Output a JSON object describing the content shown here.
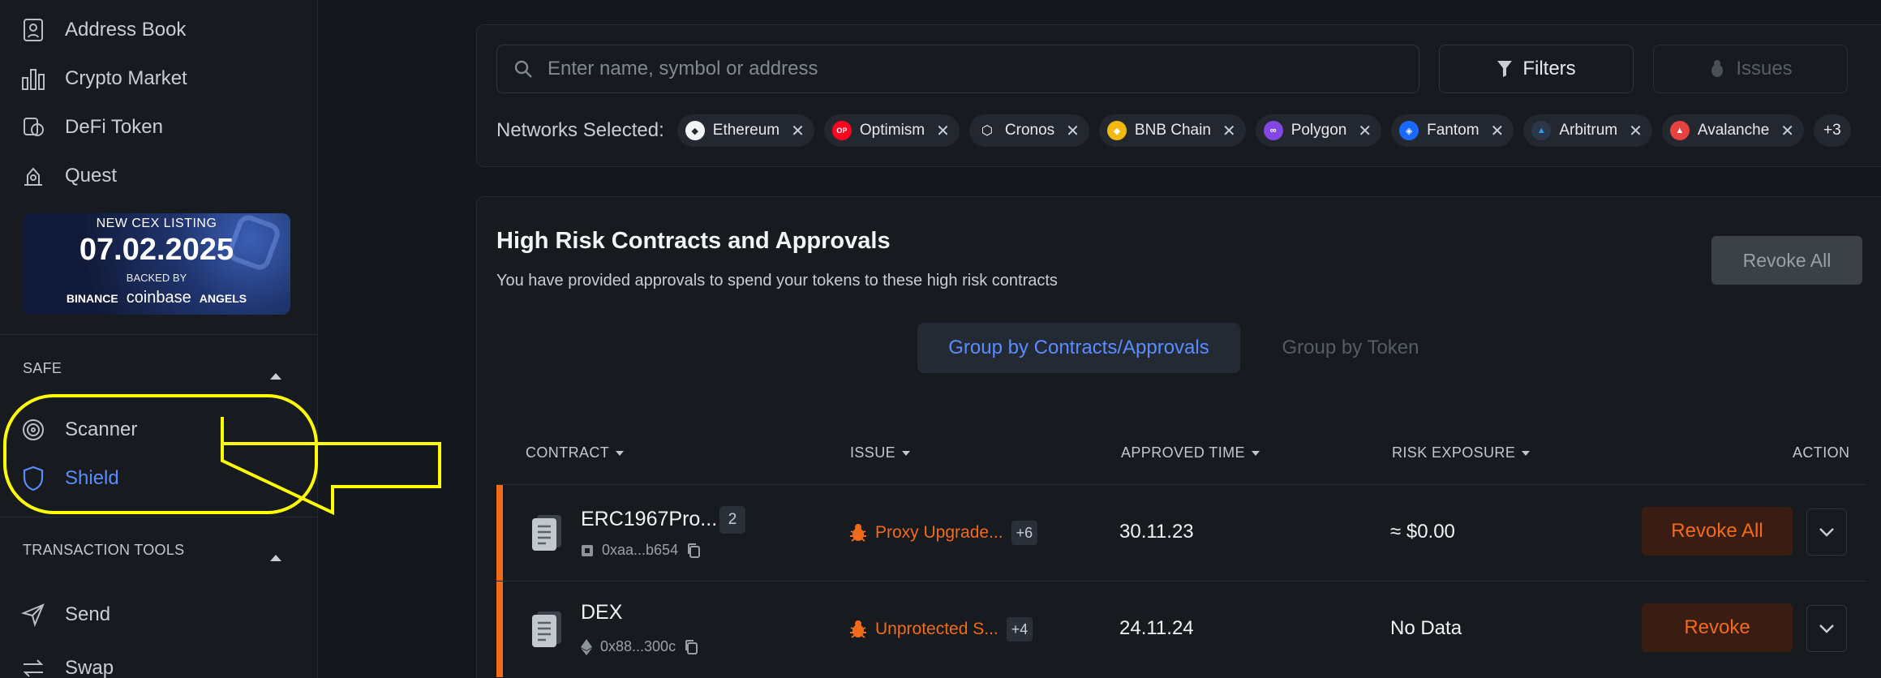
{
  "sidebar": {
    "nav_top": [
      {
        "label": "Address Book",
        "icon": "address-book-icon"
      },
      {
        "label": "Crypto Market",
        "icon": "bar-chart-icon"
      },
      {
        "label": "DeFi Token",
        "icon": "defi-token-icon"
      },
      {
        "label": "Quest",
        "icon": "quest-icon"
      }
    ],
    "banner": {
      "line1": "NEW CEX LISTING",
      "date": "07.02.2025",
      "line3": "BACKED BY",
      "partners": [
        "BINANCE",
        "coinbase",
        "ANGELS"
      ]
    },
    "safe_label": "SAFE",
    "safe_items": [
      {
        "label": "Scanner",
        "icon": "scanner-icon"
      },
      {
        "label": "Shield",
        "icon": "shield-icon"
      }
    ],
    "tx_tools_label": "TRANSACTION TOOLS",
    "tx_items": [
      {
        "label": "Send",
        "icon": "send-icon"
      },
      {
        "label": "Swap",
        "icon": "swap-icon"
      }
    ]
  },
  "filters": {
    "search_placeholder": "Enter name, symbol or address",
    "filters_label": "Filters",
    "issues_label": "Issues",
    "networks_label": "Networks Selected:",
    "networks": [
      {
        "name": "Ethereum",
        "color": "#e6e8eb",
        "glyph": "◆"
      },
      {
        "name": "Optimism",
        "color": "#ff0420",
        "glyph": "OP"
      },
      {
        "name": "Cronos",
        "color": "#ffffff",
        "glyph": "⬡"
      },
      {
        "name": "BNB Chain",
        "color": "#f0b90b",
        "glyph": "◆"
      },
      {
        "name": "Polygon",
        "color": "#8247e5",
        "glyph": "∞"
      },
      {
        "name": "Fantom",
        "color": "#1969ff",
        "glyph": "◈"
      },
      {
        "name": "Arbitrum",
        "color": "#2d374b",
        "glyph": "▲"
      },
      {
        "name": "Avalanche",
        "color": "#e84142",
        "glyph": "▲"
      }
    ],
    "more_networks": "+3"
  },
  "risk": {
    "title": "High Risk Contracts and Approvals",
    "subtitle": "You have provided approvals to spend your tokens to these high risk contracts",
    "revoke_all_label": "Revoke All",
    "group_tabs": [
      "Group by Contracts/Approvals",
      "Group by Token"
    ],
    "columns": [
      "CONTRACT",
      "ISSUE",
      "APPROVED TIME",
      "RISK EXPOSURE",
      "ACTION"
    ],
    "rows": [
      {
        "name": "ERC1967Pro...",
        "count": "2",
        "address": "0xaa...b654",
        "issue": "Proxy Upgrade...",
        "issue_more": "+6",
        "time": "30.11.23",
        "risk": "≈ $0.00",
        "action": "Revoke All"
      },
      {
        "name": "DEX",
        "count": "",
        "address": "0x88...300c",
        "issue": "Unprotected S...",
        "issue_more": "+4",
        "time": "24.11.24",
        "risk": "No Data",
        "action": "Revoke"
      }
    ]
  },
  "colors": {
    "accent": "#5b8cff",
    "danger": "#f26a1b",
    "annotation": "#ffff00"
  }
}
